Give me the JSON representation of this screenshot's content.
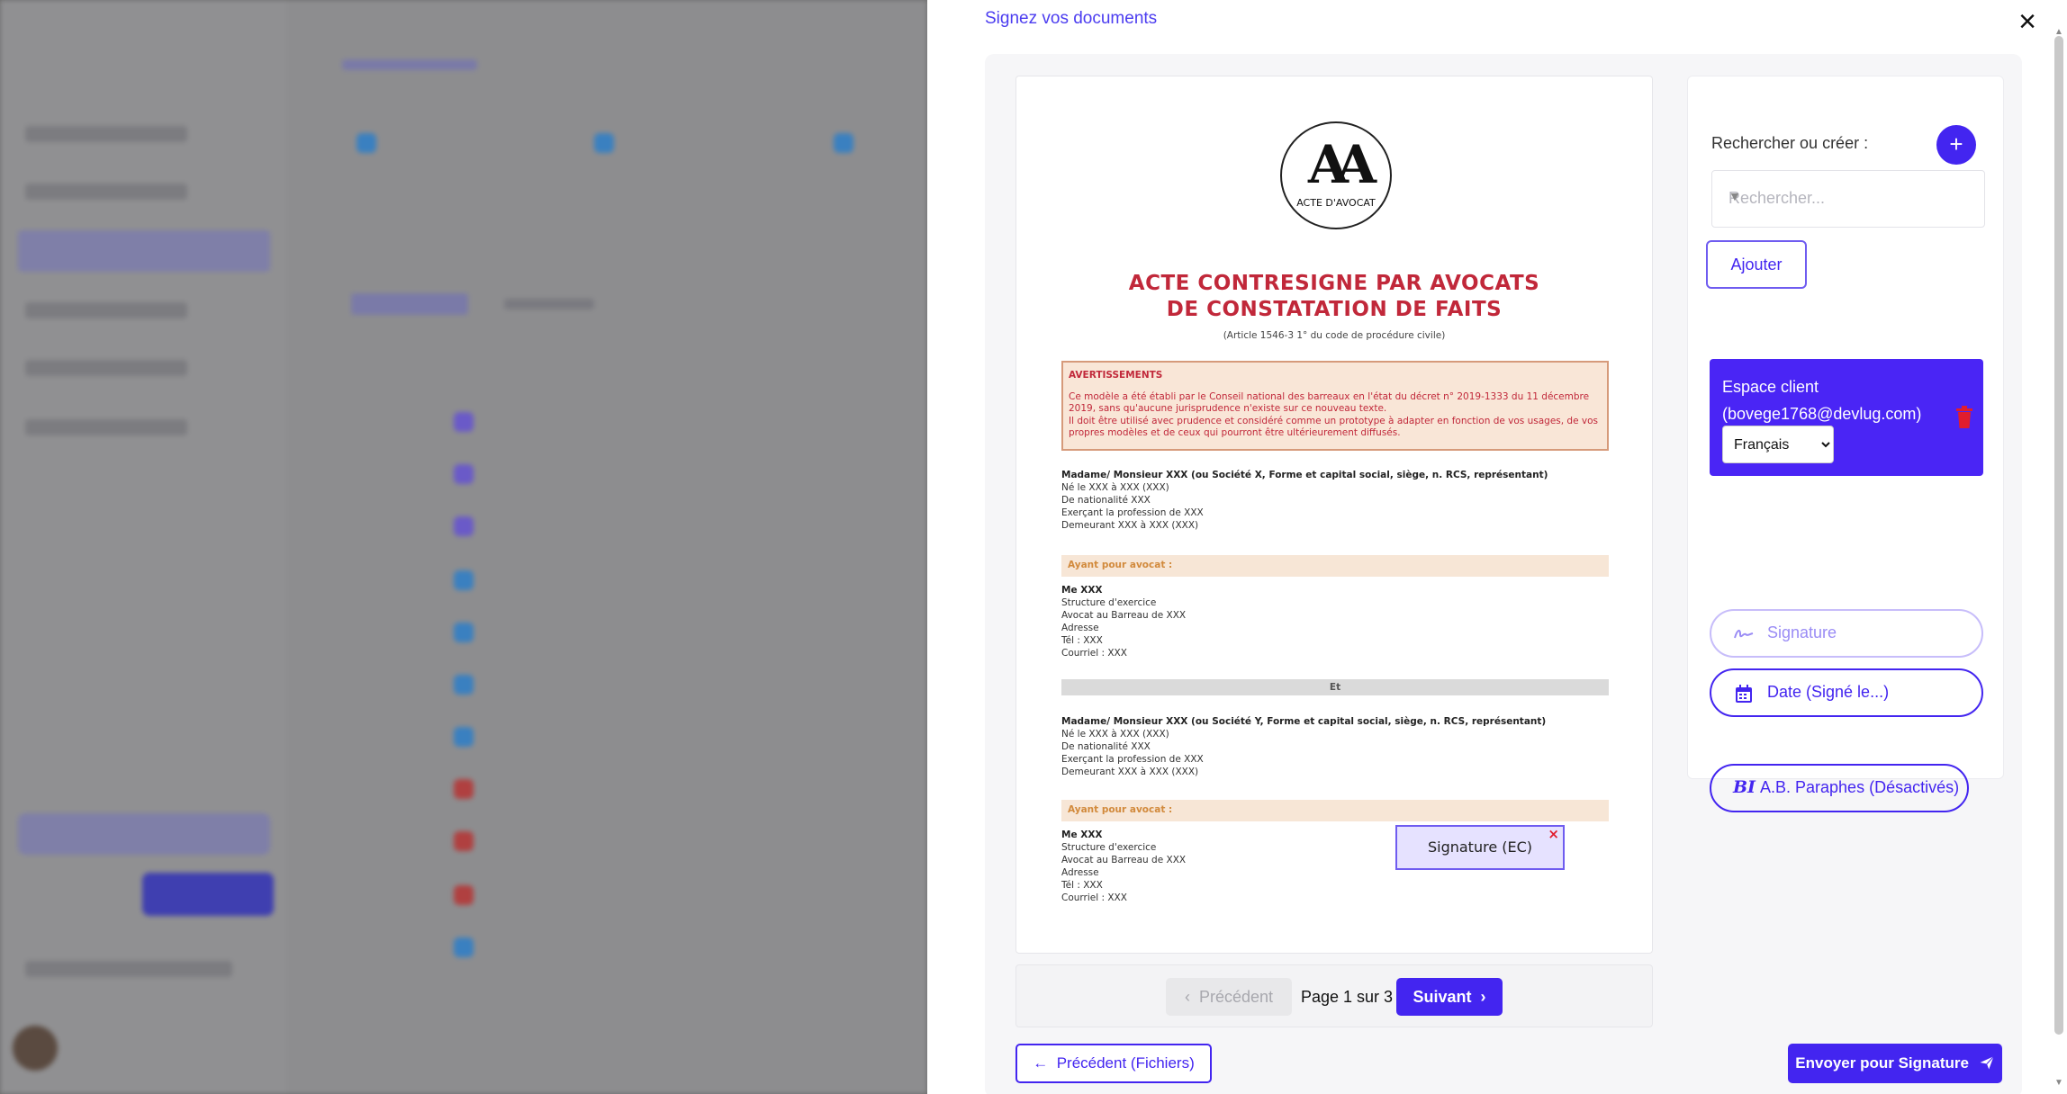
{
  "panel": {
    "title": "Signez vos documents",
    "close_label": "×"
  },
  "document": {
    "logo_text": "ACTE D'AVOCAT",
    "title_line1": "ACTE CONTRESIGNE PAR AVOCATS",
    "title_line2": "DE CONSTATATION DE FAITS",
    "subtitle": "(Article 1546-3 1° du code de procédure civile)",
    "warning_title": "AVERTISSEMENTS",
    "warning_line1": "Ce modèle a été établi par le Conseil national des barreaux en l'état du décret n° 2019-1333 du 11 décembre 2019, sans qu'aucune jurisprudence n'existe sur ce nouveau texte.",
    "warning_line2": "Il doit être utilisé avec prudence et considéré comme un prototype à adapter en fonction de vos usages, de vos propres modèles et de ceux qui pourront être ultérieurement diffusés.",
    "party1_header": "Madame/ Monsieur XXX (ou Société X, Forme et capital social, siège, n. RCS, représentant)",
    "party2_header": "Madame/ Monsieur XXX (ou Société Y, Forme et capital social, siège, n. RCS, représentant)",
    "party_lines": [
      "Né le XXX à XXX (XXX)",
      "De nationalité XXX",
      "Exerçant la profession de XXX",
      "Demeurant XXX à XXX (XXX)"
    ],
    "lawyer_band": "Ayant pour avocat :",
    "lawyer_lines": [
      "Me XXX",
      "Structure d'exercice",
      "Avocat au Barreau de XXX",
      "Adresse",
      "Tél : XXX",
      "Courriel : XXX"
    ],
    "separator": "Et",
    "signature_field": "Signature (EC)",
    "signature_remove": "×"
  },
  "pager": {
    "prev": "Précédent",
    "info": "Page 1 sur 3",
    "next": "Suivant"
  },
  "footer": {
    "back_label": "Précédent (Fichiers)",
    "send_label": "Envoyer pour Signature"
  },
  "sidebar": {
    "search_label": "Rechercher ou créer :",
    "search_placeholder": "Rechercher...",
    "add_label": "Ajouter",
    "client_name": "Espace client (bovege1768@devlug.com)",
    "language_options": [
      "Français"
    ],
    "language_selected": "Français",
    "signature_btn": "Signature",
    "date_btn": "Date (Signé le...)",
    "paraph_icon_text": "BI",
    "paraph_btn": "A.B. Paraphes (Désactivés)"
  },
  "colors": {
    "accent": "#4325f0",
    "client_card": "#4a25f5",
    "doc_red": "#c1283a",
    "trash": "#e11d2e"
  }
}
